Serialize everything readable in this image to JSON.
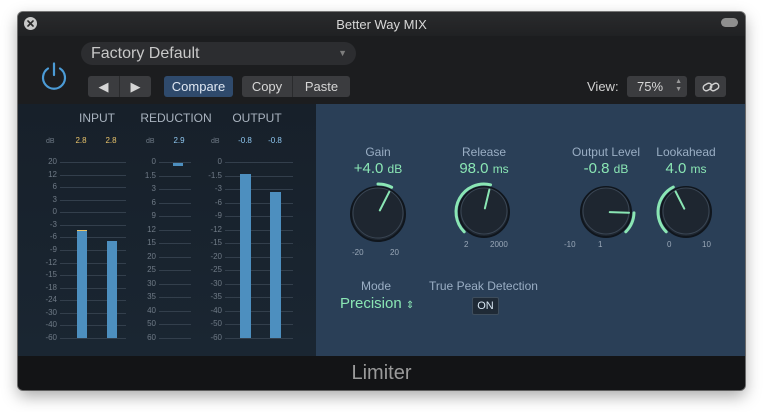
{
  "window": {
    "title": "Better Way MIX"
  },
  "toolbar": {
    "preset": "Factory Default",
    "prev_label": "◀",
    "next_label": "▶",
    "compare_label": "Compare",
    "copy_label": "Copy",
    "paste_label": "Paste",
    "view_label": "View:",
    "view_value": "75%"
  },
  "meters": {
    "input_label": "INPUT",
    "reduction_label": "REDUCTION",
    "output_label": "OUTPUT",
    "db_unit": "dB",
    "input_values": [
      "2.8",
      "2.8"
    ],
    "reduction_value": "2.9",
    "output_values": [
      "-0.8",
      "-0.8"
    ],
    "input_scale": [
      "20",
      "12",
      "6",
      "3",
      "0",
      "-3",
      "-6",
      "-9",
      "-12",
      "-15",
      "-18",
      "-24",
      "-30",
      "-40",
      "-60"
    ],
    "reduction_scale": [
      "0",
      "1.5",
      "3",
      "6",
      "9",
      "12",
      "15",
      "20",
      "25",
      "30",
      "35",
      "40",
      "50",
      "60"
    ],
    "output_scale": [
      "0",
      "-1.5",
      "-3",
      "-6",
      "-9",
      "-12",
      "-15",
      "-20",
      "-25",
      "-30",
      "-35",
      "-40",
      "-50",
      "-60"
    ]
  },
  "controls": {
    "gain": {
      "label": "Gain",
      "value": "+4.0",
      "unit": "dB",
      "min": "-20",
      "max": "20",
      "fraction": 0.6
    },
    "release": {
      "label": "Release",
      "value": "98.0",
      "unit": "ms",
      "min": "2",
      "max": "2000",
      "fraction": 0.55
    },
    "output_level": {
      "label": "Output Level",
      "value": "-0.8",
      "unit": "dB",
      "min": "-10",
      "max": "1",
      "fraction": 0.84
    },
    "lookahead": {
      "label": "Lookahead",
      "value": "4.0",
      "unit": "ms",
      "min": "0",
      "max": "10",
      "fraction": 0.4
    },
    "mode_label": "Mode",
    "mode_value": "Precision",
    "true_peak_label": "True Peak Detection",
    "true_peak_value": "ON"
  },
  "footer": {
    "name": "Limiter"
  },
  "colors": {
    "accent": "#8ae6b4",
    "meter": "#4d8fbf",
    "power": "#4b9bd6",
    "panel": "#2a3f57"
  }
}
